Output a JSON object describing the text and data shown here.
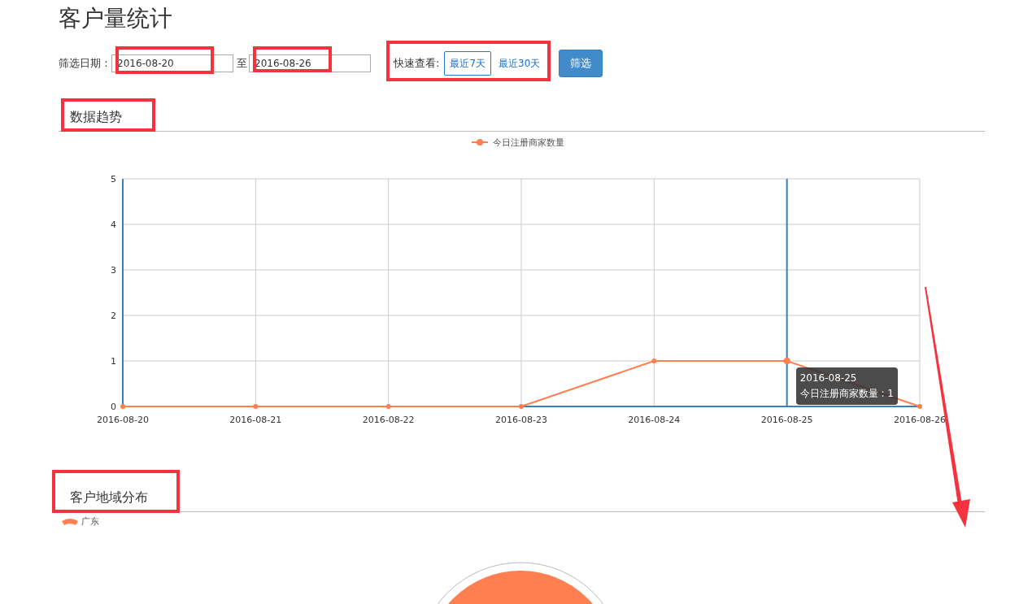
{
  "page_title": "客户量统计",
  "filter": {
    "label": "筛选日期：",
    "start": "2016-08-20",
    "separator": "至",
    "end": "2016-08-26",
    "quick_label": "快速查看:",
    "quick_options": [
      {
        "label": "最近7天",
        "selected": true
      },
      {
        "label": "最近30天",
        "selected": false
      }
    ],
    "submit": "筛选"
  },
  "trend_section": {
    "title": "数据趋势",
    "chart_data": {
      "type": "line",
      "categories": [
        "2016-08-20",
        "2016-08-21",
        "2016-08-22",
        "2016-08-23",
        "2016-08-24",
        "2016-08-25",
        "2016-08-26"
      ],
      "series": [
        {
          "name": "今日注册商家数量",
          "color": "#ff7f50",
          "values": [
            0,
            0,
            0,
            0,
            1,
            1,
            0
          ],
          "marker": "circle"
        }
      ],
      "ylim": [
        0,
        5
      ],
      "yticks": [
        0,
        1,
        2,
        3,
        4,
        5
      ],
      "grid": true,
      "ref_lines": [
        {
          "axis": "x",
          "value": "2016-08-25",
          "color": "#3a7fc1"
        }
      ]
    },
    "tooltip": {
      "title": "2016-08-25",
      "text": "今日注册商家数量 : 1"
    }
  },
  "region_section": {
    "title": "客户地域分布",
    "legend": [
      {
        "label": "广东",
        "color": "#ff7f50"
      }
    ]
  }
}
